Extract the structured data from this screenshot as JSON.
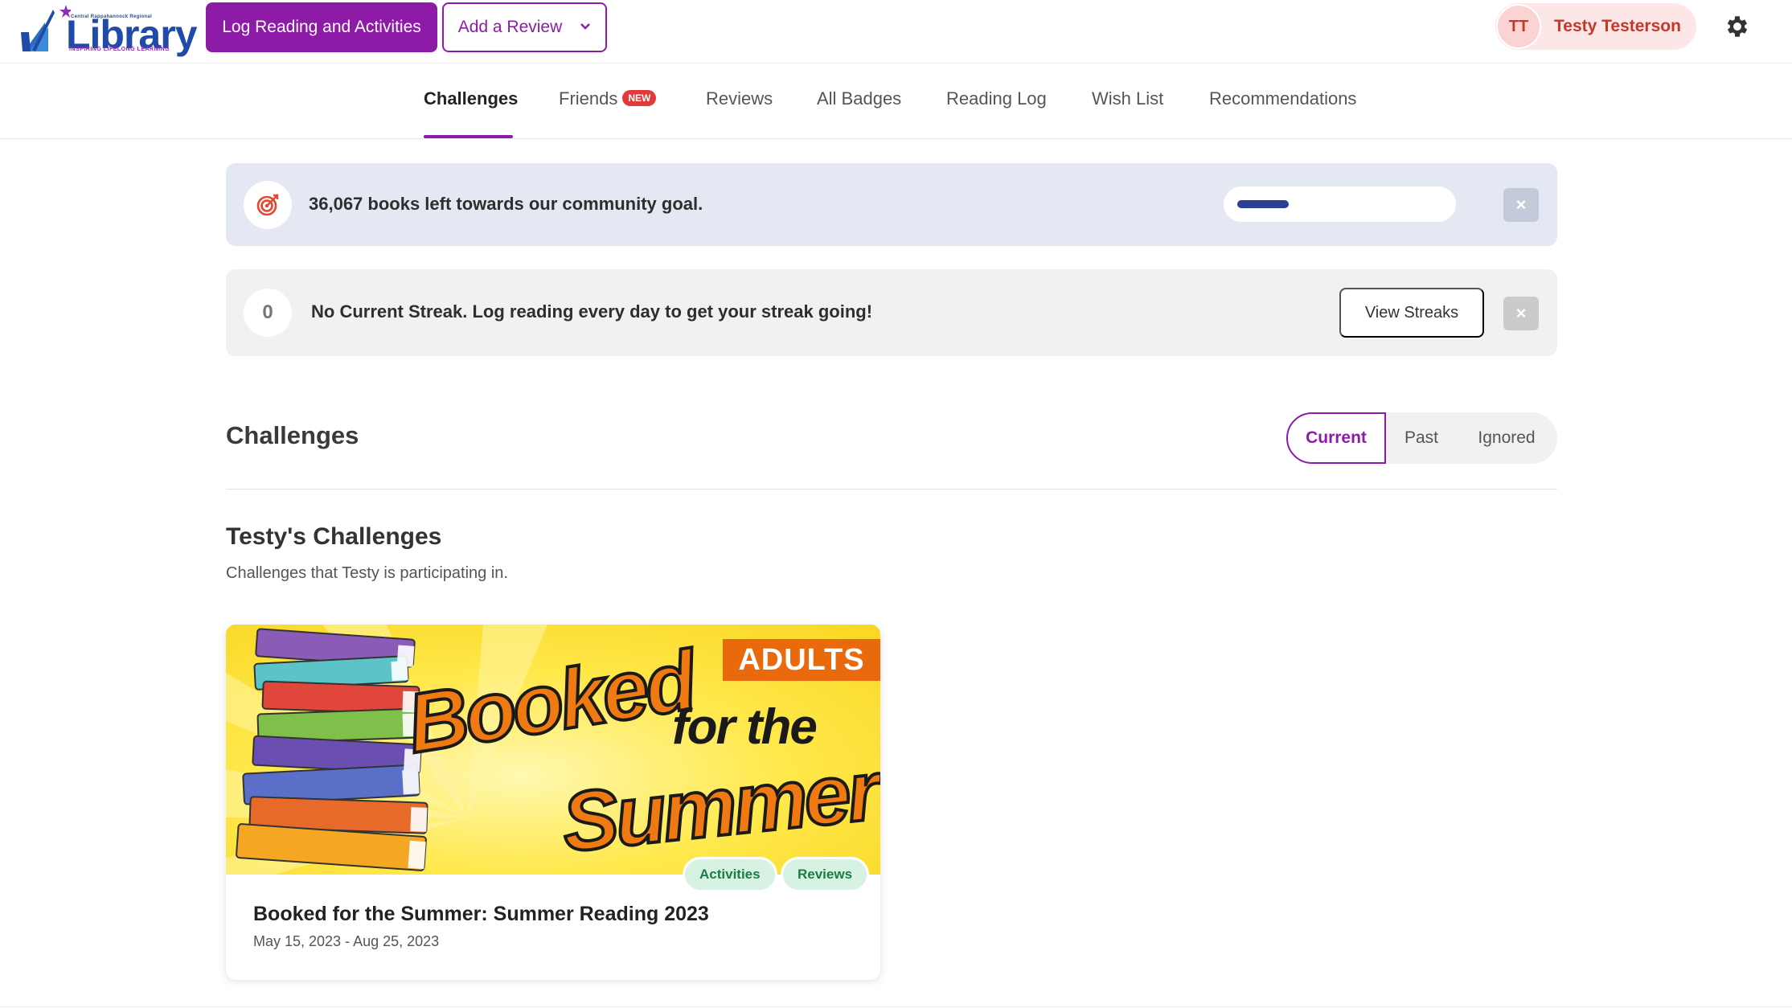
{
  "header": {
    "logo": {
      "top_text": "Central Rappahannock Regional",
      "word": "Library",
      "tagline": "INSPIRING LIFELONG LEARNING"
    },
    "log_button": "Log Reading and Activities",
    "review_button": "Add a Review",
    "user": {
      "initials": "TT",
      "name": "Testy Testerson"
    }
  },
  "nav": {
    "tabs": [
      {
        "label": "Challenges",
        "active": true
      },
      {
        "label": "Friends",
        "badge": "NEW"
      },
      {
        "label": "Reviews"
      },
      {
        "label": "All Badges"
      },
      {
        "label": "Reading Log"
      },
      {
        "label": "Wish List"
      },
      {
        "label": "Recommendations"
      }
    ]
  },
  "goal_banner": {
    "text": "36,067 books left towards our community goal.",
    "progress": 0.25,
    "close": "×"
  },
  "streak_banner": {
    "count": "0",
    "text": "No Current Streak. Log reading every day to get your streak going!",
    "button": "View Streaks",
    "close": "×"
  },
  "challenges": {
    "title": "Challenges",
    "filters": [
      "Current",
      "Past",
      "Ignored"
    ],
    "active_filter": "Current",
    "subtitle": "Testy's Challenges",
    "description": "Challenges that Testy is participating in.",
    "cards": [
      {
        "image_text": {
          "badge": "ADULTS",
          "line1": "Booked",
          "line2": "for the",
          "line3": "Summer"
        },
        "tags": [
          "Activities",
          "Reviews"
        ],
        "title": "Booked for the Summer: Summer Reading 2023",
        "dates": "May 15, 2023 - Aug 25, 2023"
      }
    ]
  },
  "colors": {
    "brand": "#8e1aa8",
    "user": "#c0392b",
    "progress": "#2b3f96",
    "tag_bg": "#d7f2e3",
    "tag_text": "#1e7a45"
  }
}
